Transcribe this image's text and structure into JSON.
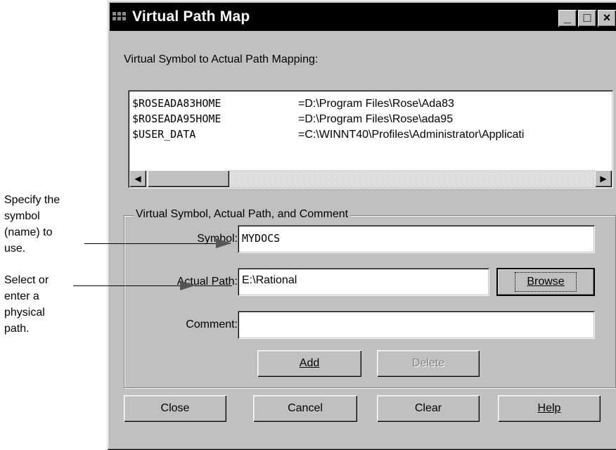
{
  "annotations": {
    "symbol_note": "Specify the\nsymbol\n(name) to\nuse.",
    "path_note": "Select or\nenter a\nphysical\npath."
  },
  "window": {
    "title": "Virtual Path Map",
    "title_buttons": [
      "_",
      "□",
      "×"
    ]
  },
  "mapping": {
    "heading": "Virtual Symbol to Actual Path Mapping:",
    "rows": [
      {
        "symbol": "$ROSEADA83HOME",
        "path": "=D:\\Program Files\\Rose\\Ada83"
      },
      {
        "symbol": "$ROSEADA95HOME",
        "path": "=D:\\Program Files\\Rose\\ada95"
      },
      {
        "symbol": "$USER_DATA",
        "path": "=C:\\WINNT40\\Profiles\\Administrator\\Applicati"
      }
    ],
    "scroll_left": "◀",
    "scroll_right": "▶"
  },
  "group": {
    "title": "Virtual Symbol, Actual Path, and Comment",
    "symbol_label": "Symbol:",
    "symbol_value": "MYDOCS",
    "path_label": "Actual Path:",
    "path_value": "E:\\Rational",
    "comment_label": "Comment:",
    "comment_value": "",
    "browse_label": "Browse",
    "add_label": "Add",
    "delete_label": "Delete"
  },
  "footer": {
    "close_label": "Close",
    "cancel_label": "Cancel",
    "clear_label": "Clear",
    "help_label": "Help"
  }
}
